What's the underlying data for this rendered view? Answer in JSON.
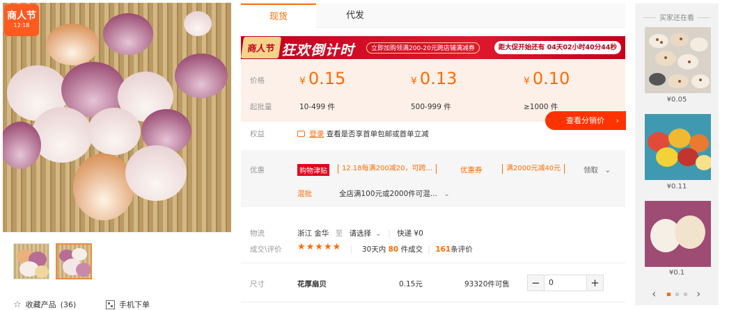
{
  "gallery": {
    "badge_text": "商人节",
    "badge_date": "12·18",
    "collect_label": "收藏产品",
    "collect_count": "(36)",
    "mobile_order_label": "手机下单"
  },
  "tabs": [
    "现货",
    "代发"
  ],
  "banner": {
    "logo_text": "商人节",
    "headline": "狂欢倒计时",
    "promo": "立即加购领满200-20元跨店铺满减券",
    "countdown": "距大促开始还有 04天02小时40分44秒"
  },
  "pricing": {
    "price_label": "价格",
    "moq_label": "起批量",
    "currency": "¥",
    "tiers": [
      {
        "price": "0.15",
        "qty": "10-499 件"
      },
      {
        "price": "0.13",
        "qty": "500-999 件"
      },
      {
        "price": "0.10",
        "qty": "≥1000 件"
      }
    ],
    "distribution_btn": "查看分销价"
  },
  "rights": {
    "label": "权益",
    "login_link": "登录",
    "text": "查看是否享首单包邮或首单立减"
  },
  "discount": {
    "label": "优惠",
    "tag": "购物津贴",
    "allowance_text": "12.18每满200减20，可跨...",
    "coupon_label": "优惠券",
    "coupon_text": "满2000元减40元",
    "claim": "领取",
    "mixed_label": "混批",
    "mixed_text": "全店满100元或2000件可混..."
  },
  "logistics": {
    "label": "物流",
    "origin": "浙江 金华",
    "to": "至",
    "select": "请选择",
    "shipping": "快递 ¥0"
  },
  "reviews": {
    "label": "成交\\评价",
    "stars": "★★★★★",
    "days_prefix": "30天内",
    "sold_count": "80",
    "sold_suffix": "件成交",
    "review_count": "161",
    "review_suffix": "条评价"
  },
  "sku": {
    "label": "尺寸",
    "name": "花厚扇贝",
    "price": "0.15元",
    "stock": "93320件可售",
    "quantity": "0",
    "minus": "−",
    "plus": "+"
  },
  "sidebar": {
    "title": "买家还在看",
    "items": [
      {
        "price": "¥0.05"
      },
      {
        "price": "¥0.11"
      },
      {
        "price": "¥0.1"
      }
    ]
  },
  "colors": {
    "accent": "#ff6a00",
    "banner_red": "#e0182e",
    "button_red": "#ff3300"
  }
}
